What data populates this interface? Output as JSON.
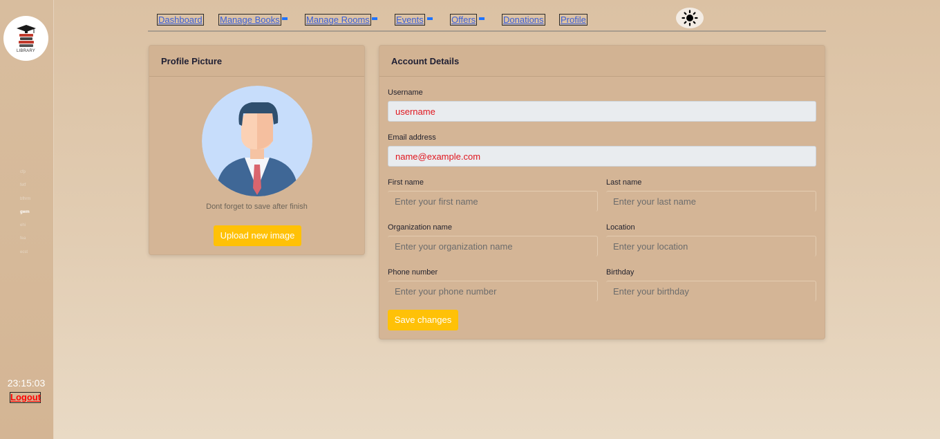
{
  "sidebar": {
    "logo_text": "LIBRARY",
    "clock": "23:15:03",
    "logout_label": "Logout",
    "faint_items": [
      "cfp",
      "fetf",
      "bfhrm",
      "gwm",
      "ehi",
      "fea",
      "ecst"
    ]
  },
  "nav": {
    "items": [
      {
        "label": "Dashboard"
      },
      {
        "label": "Manage Books"
      },
      {
        "label": "Manage Rooms"
      },
      {
        "label": "Events"
      },
      {
        "label": "Offers"
      },
      {
        "label": "Donations"
      },
      {
        "label": "Profile"
      }
    ],
    "theme_icon": "sun-icon"
  },
  "profile_card": {
    "title": "Profile Picture",
    "hint": "Dont forget to save after finish",
    "upload_label": "Upload new image"
  },
  "account_card": {
    "title": "Account Details",
    "username": {
      "label": "Username",
      "value": "username"
    },
    "email": {
      "label": "Email address",
      "value": "name@example.com"
    },
    "first_name": {
      "label": "First name",
      "placeholder": "Enter your first name"
    },
    "last_name": {
      "label": "Last name",
      "placeholder": "Enter your last name"
    },
    "organization": {
      "label": "Organization name",
      "placeholder": "Enter your organization name"
    },
    "location": {
      "label": "Location",
      "placeholder": "Enter your location"
    },
    "phone": {
      "label": "Phone number",
      "placeholder": "Enter your phone number"
    },
    "birthday": {
      "label": "Birthday",
      "placeholder": "Enter your birthday"
    },
    "save_label": "Save changes"
  },
  "colors": {
    "accent": "#ffc107",
    "link": "#3a5fd9",
    "danger": "#ff0000",
    "card": "#d4b596"
  }
}
